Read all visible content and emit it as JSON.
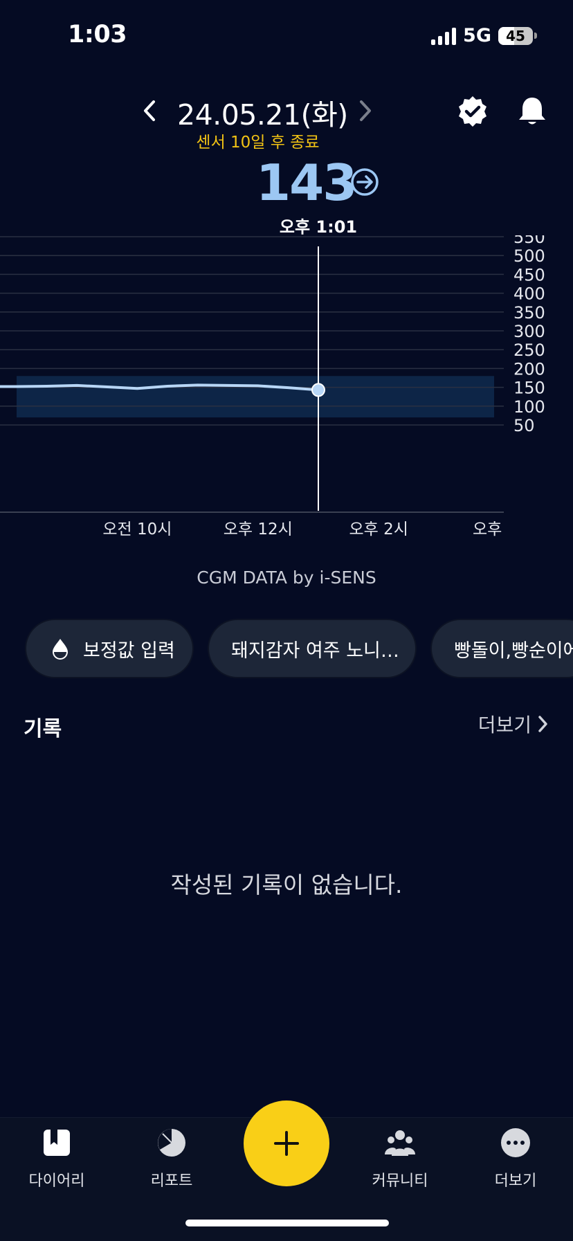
{
  "status_bar": {
    "time": "1:03",
    "network": "5G",
    "battery": "45",
    "battery_level": 0.45
  },
  "header": {
    "date": "24.05.21(화)",
    "sensor_notice": "센서 10일 후 종료"
  },
  "reading": {
    "value": "143",
    "time": "오후 1:01"
  },
  "chart_data": {
    "type": "line",
    "x_tick_labels": [
      "오전 10시",
      "오후 12시",
      "오후 2시",
      "오후"
    ],
    "y_tick_labels": [
      "550",
      "500",
      "450",
      "400",
      "350",
      "300",
      "250",
      "200",
      "150",
      "100",
      "50"
    ],
    "ylim": [
      0,
      550
    ],
    "target_range": [
      70,
      180
    ],
    "series": [
      {
        "x": [
          8.0,
          8.5,
          9.0,
          9.5,
          10.0,
          10.5,
          11.0,
          11.5,
          12.0,
          12.5,
          13.0
        ],
        "values": [
          152,
          153,
          155,
          151,
          147,
          153,
          156,
          155,
          154,
          149,
          143
        ]
      }
    ],
    "selected_point": {
      "x": 13.0,
      "value": 143
    },
    "colors": {
      "line": "#b7d6f6",
      "band": "#0f2a4d",
      "cursor": "#ffffff"
    }
  },
  "credit": "CGM DATA by i-SENS",
  "chips": [
    {
      "label": "보정값 입력",
      "icon": "drop-icon"
    },
    {
      "label": "돼지감자 여주 노니…"
    },
    {
      "label": "빵돌이,빵순이에"
    }
  ],
  "records": {
    "title": "기록",
    "more": "더보기",
    "empty": "작성된 기록이 없습니다."
  },
  "tabs": [
    {
      "label": "다이어리",
      "icon": "diary-icon"
    },
    {
      "label": "리포트",
      "icon": "report-icon"
    },
    {
      "label": "커뮤니티",
      "icon": "community-icon"
    },
    {
      "label": "더보기",
      "icon": "more-icon"
    }
  ],
  "colors": {
    "background": "#050b23",
    "accent": "#f9cf17",
    "glucose": "#9cc7f3",
    "sensor_notice": "#f2c314"
  }
}
